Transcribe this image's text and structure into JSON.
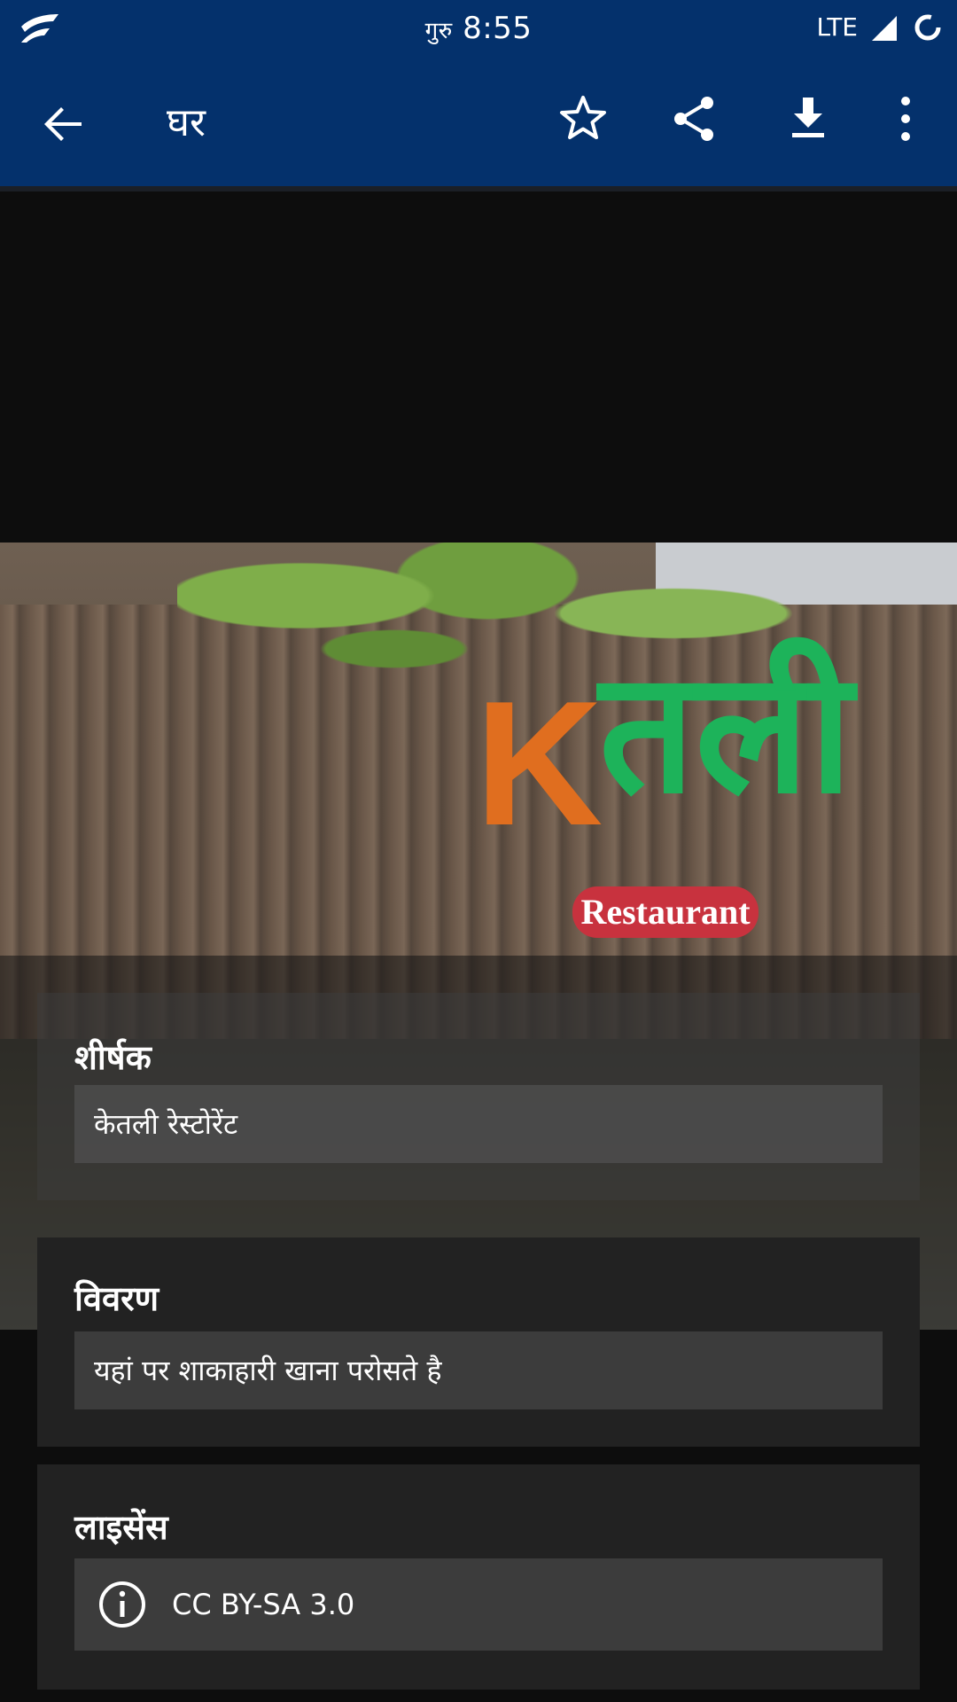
{
  "status_bar": {
    "day": "गुरु",
    "time": "8:55",
    "network": "LTE",
    "icons": [
      "app-logo-icon",
      "signal-icon",
      "sync-icon"
    ]
  },
  "app_bar": {
    "title": "घर",
    "actions": [
      "back-icon",
      "star-icon",
      "share-icon",
      "download-icon",
      "more-vert-icon"
    ]
  },
  "photo": {
    "sign_k": "K",
    "sign_word": "तली",
    "sign_badge": "Restaurant"
  },
  "caption": {
    "label": "शीर्षक",
    "value": "केतली रेस्टोरेंट"
  },
  "description": {
    "label": "विवरण",
    "value": "यहां पर शाकाहारी खाना परोसते है"
  },
  "license": {
    "label": "लाइसेंस",
    "value": "CC BY-SA 3.0",
    "icon": "info-icon"
  },
  "colors": {
    "app_bar": "#04316c",
    "background": "#0d0d0d",
    "card": "#222222",
    "field": "#3c3c3c"
  }
}
